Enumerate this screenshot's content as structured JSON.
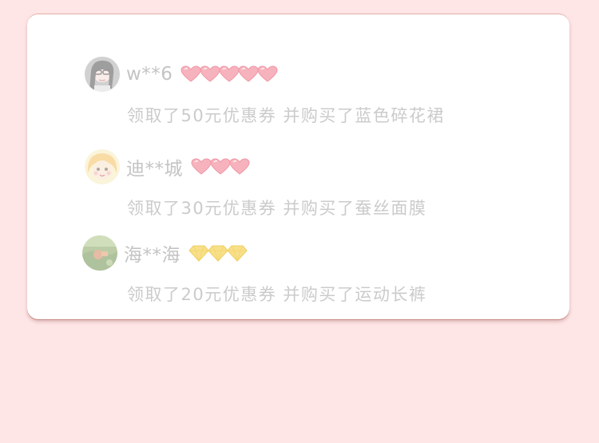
{
  "feed": {
    "entries": [
      {
        "avatar_icon": "woman-portrait-avatar",
        "username": "w**6",
        "badge_icon": "pink-heart-icon",
        "badge_count": 5,
        "message": "领取了50元优惠券 并购买了蓝色碎花裙"
      },
      {
        "avatar_icon": "cartoon-girl-avatar",
        "username": "迪**城",
        "badge_icon": "pink-heart-icon",
        "badge_count": 3,
        "message": "领取了30元优惠券 并购买了蚕丝面膜"
      },
      {
        "avatar_icon": "landscape-avatar",
        "username": "海**海",
        "badge_icon": "yellow-diamond-icon",
        "badge_count": 3,
        "message": "领取了20元优惠券 并购买了运动长裤"
      }
    ]
  },
  "colors": {
    "page_background": "#ffe6e6",
    "card_background": "#ffffff",
    "heart": "#f4a9b4",
    "diamond": "#f6dc7a",
    "text": "#c4c4c4"
  }
}
